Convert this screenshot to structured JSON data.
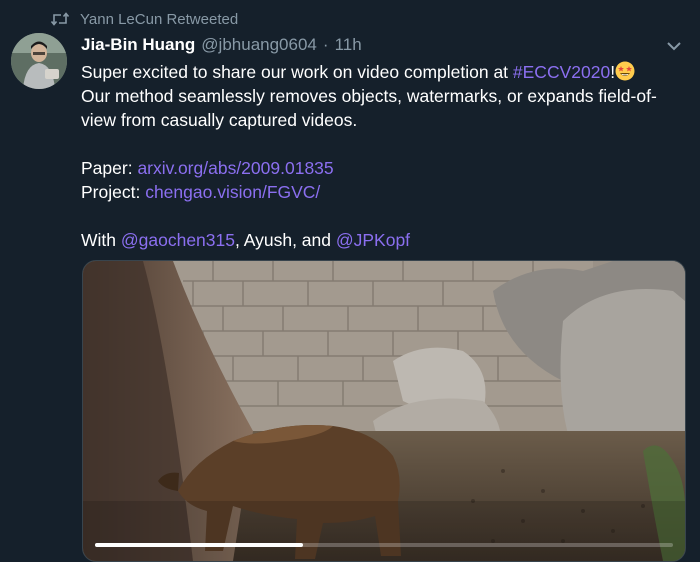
{
  "retweet": {
    "icon": "retweet-icon",
    "label": "Yann LeCun Retweeted"
  },
  "tweet": {
    "author": {
      "display_name": "Jia-Bin Huang",
      "handle": "@jbhuang0604",
      "separator": "·",
      "time": "11h",
      "avatar_icon": "avatar"
    },
    "menu_icon": "chevron-down-icon",
    "line1_text": "Super excited to share our work on video completion at ",
    "line1_hashtag": "#ECCV2020",
    "line1_end": "!",
    "line1_emoji": "star-struck-emoji-icon",
    "line2": "Our method seamlessly removes objects, watermarks, or expands field-of-view from casually captured videos.",
    "paper_label": "Paper: ",
    "paper_link": "arxiv.org/abs/2009.01835",
    "project_label": "Project: ",
    "project_link": "chengao.vision/FGVC/",
    "with_label": "With ",
    "mention1": "@gaochen315",
    "with_middle": ", Ayush, and ",
    "mention2": "@JPKopf"
  },
  "media": {
    "type": "video",
    "progress": 0.36
  },
  "colors": {
    "background": "#15202b",
    "link": "#8b6ff0",
    "secondary_text": "#8899a6"
  }
}
